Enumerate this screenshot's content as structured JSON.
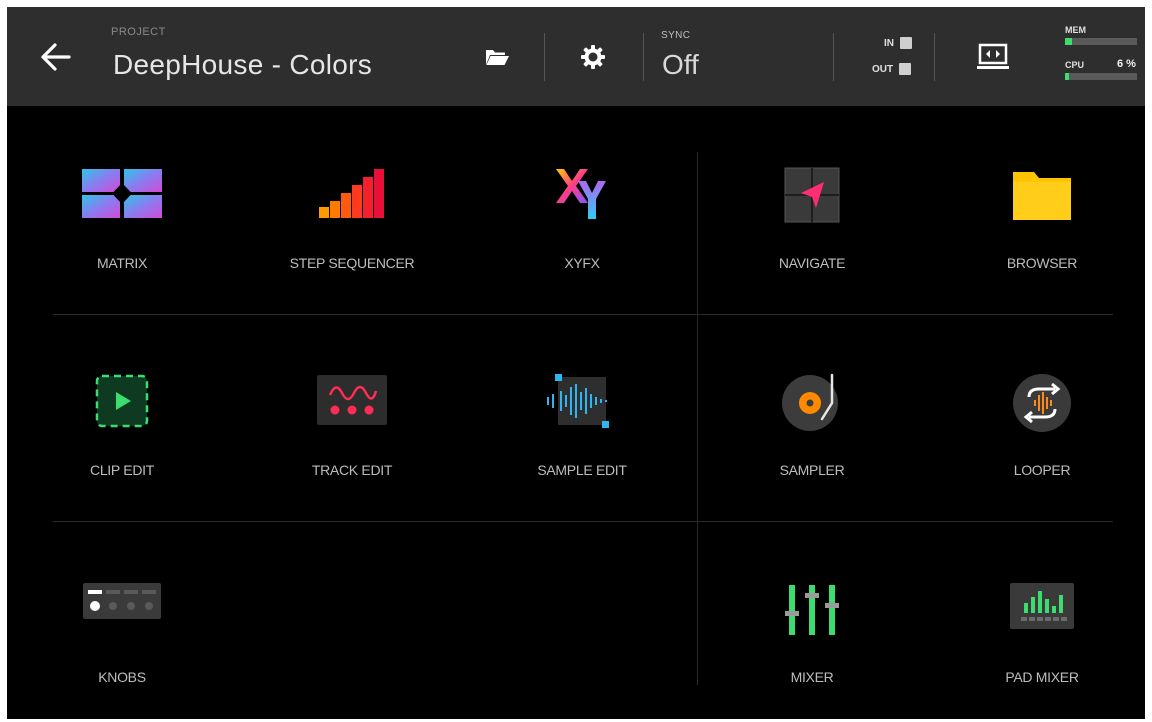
{
  "header": {
    "project_label": "PROJECT",
    "project_name": "DeepHouse - Colors",
    "sync_label": "SYNC",
    "sync_value": "Off",
    "in_label": "IN",
    "out_label": "OUT",
    "mem_label": "MEM",
    "cpu_label": "CPU",
    "cpu_value": "6 %",
    "mem_fill_fraction": 0.1,
    "cpu_fill_fraction": 0.06
  },
  "tiles": {
    "matrix": "MATRIX",
    "step_sequencer": "STEP SEQUENCER",
    "xyfx": "XYFX",
    "navigate": "NAVIGATE",
    "browser": "BROWSER",
    "clip_edit": "CLIP EDIT",
    "track_edit": "TRACK EDIT",
    "sample_edit": "SAMPLE EDIT",
    "sampler": "SAMPLER",
    "looper": "LOOPER",
    "knobs": "KNOBS",
    "mixer": "MIXER",
    "pad_mixer": "PAD MIXER"
  },
  "colors": {
    "header_bg": "#2e2e2f",
    "background": "#000000",
    "accent_green": "#3ddc6e",
    "browser_yellow": "#ffc400",
    "navigate_pink": "#ff2d72",
    "sample_edit_cyan": "#2fb6f0"
  },
  "icons": {
    "back": "arrow-left-icon",
    "open": "folder-open-icon",
    "settings": "gear-icon",
    "output_device": "monitor-icon"
  }
}
